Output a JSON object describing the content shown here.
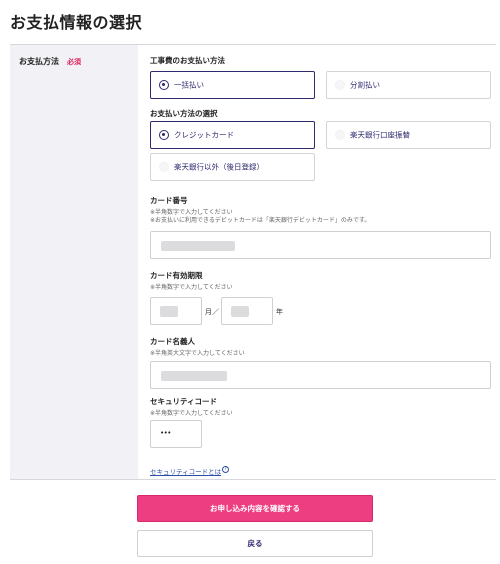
{
  "page": {
    "title": "お支払情報の選択"
  },
  "sidebar": {
    "label": "お支払方法",
    "required": "必須"
  },
  "construction": {
    "title": "工事費のお支払い方法",
    "options": [
      {
        "label": "一括払い",
        "selected": true
      },
      {
        "label": "分割払い",
        "selected": false
      }
    ]
  },
  "payment": {
    "title": "お支払い方法の選択",
    "options": [
      {
        "label": "クレジットカード",
        "selected": true
      },
      {
        "label": "楽天銀行口座振替",
        "selected": false
      },
      {
        "label": "楽天銀行以外（後日登録）",
        "selected": false
      }
    ]
  },
  "card_number": {
    "title": "カード番号",
    "note1": "※半角数字で入力してください",
    "note2": "※お支払いに利用できるデビットカードは「楽天銀行デビットカード」のみです。"
  },
  "expiry": {
    "title": "カード有効期限",
    "note": "※半角数字で入力してください",
    "month_unit": "月／",
    "year_unit": "年"
  },
  "holder": {
    "title": "カード名義人",
    "note": "※半角英大文字で入力してください"
  },
  "security": {
    "title": "セキュリティコード",
    "note": "※半角数字で入力してください",
    "value": "•••",
    "help_link": "セキュリティコードとは",
    "help_icon": "?"
  },
  "actions": {
    "confirm": "お申し込み内容を確認する",
    "back": "戻る"
  },
  "colors": {
    "accent": "#2d2a6e",
    "primary_button": "#ee3e82",
    "required": "#e0245e",
    "link": "#2b4fa8"
  }
}
